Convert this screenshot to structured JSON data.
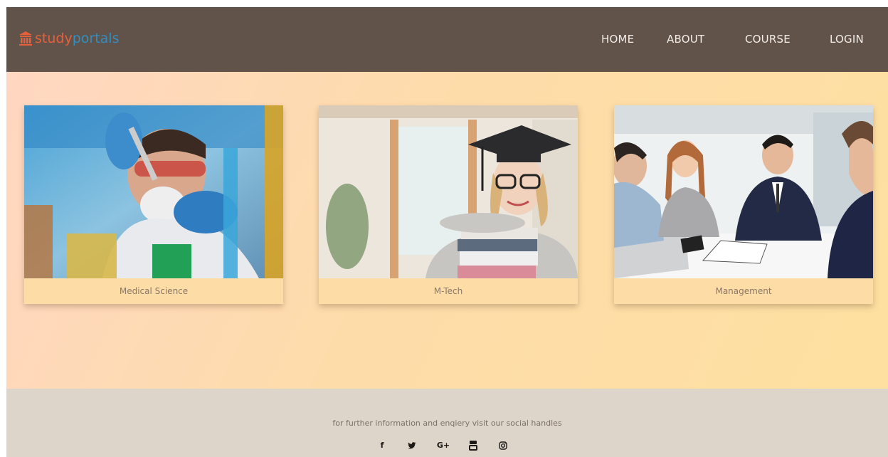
{
  "header": {
    "logo": {
      "part1": "study",
      "part2": "portals",
      "icon": "university-icon"
    },
    "nav": [
      {
        "label": "HOME"
      },
      {
        "label": "ABOUT"
      },
      {
        "label": "COURSE"
      },
      {
        "label": "LOGIN"
      }
    ]
  },
  "courses": [
    {
      "label": "Medical Science",
      "image": "scientist-lab-photo"
    },
    {
      "label": "M-Tech",
      "image": "graduate-student-photo"
    },
    {
      "label": "Management",
      "image": "business-meeting-photo"
    }
  ],
  "footer": {
    "text": "for further information and enqiery visit our social handles",
    "social": [
      {
        "glyph": "f",
        "icon": "facebook-icon"
      },
      {
        "glyph": "🐦",
        "icon": "twitter-icon"
      },
      {
        "glyph": "G+",
        "icon": "google-plus-icon"
      },
      {
        "glyph": "▶",
        "icon": "youtube-icon"
      },
      {
        "glyph": "◎",
        "icon": "instagram-icon"
      }
    ]
  },
  "colors": {
    "header_bg": "#62534a",
    "logo_primary": "#e8603a",
    "logo_secondary": "#2f8fc1",
    "main_gradient_start": "#ffd7c2",
    "main_gradient_end": "#fee0a0",
    "card_label_bg": "#fedca6",
    "footer_bg": "#ddd5c9"
  }
}
